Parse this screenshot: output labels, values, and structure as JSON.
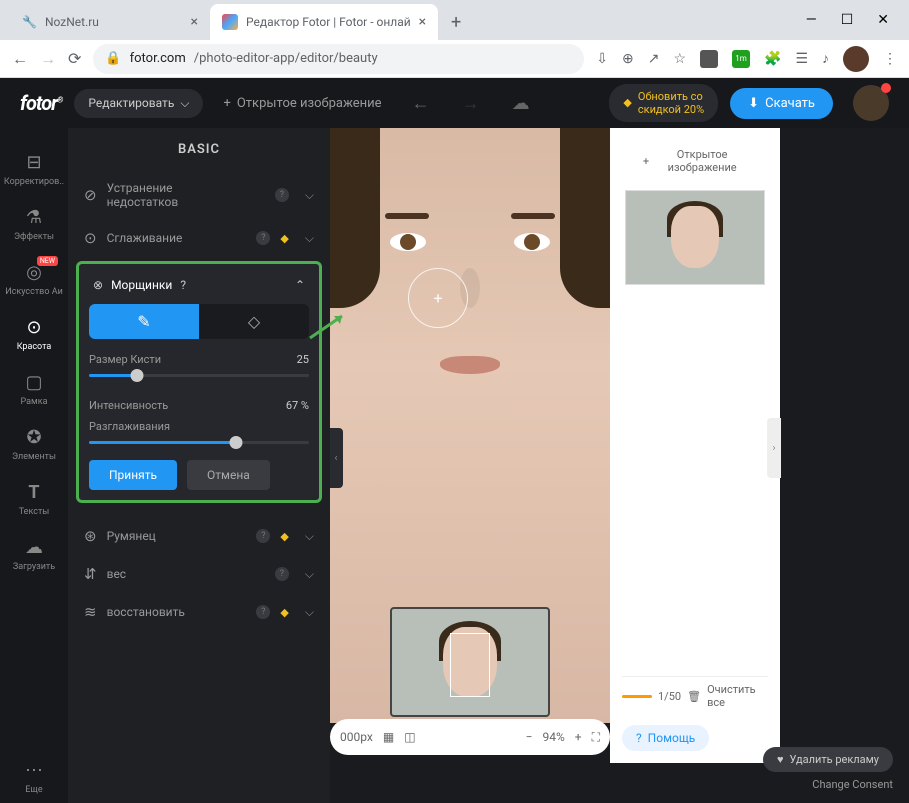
{
  "browser": {
    "tabs": [
      {
        "title": "NozNet.ru",
        "active": false
      },
      {
        "title": "Редактор Fotor | Fotor - онлай",
        "active": true
      }
    ],
    "url_host": "fotor.com",
    "url_path": "/photo-editor-app/editor/beauty",
    "ext_badge": "1m"
  },
  "topbar": {
    "logo": "fotor",
    "edit": "Редактировать",
    "open": "Открытое изображение",
    "promo_line1": "Обновить со",
    "promo_line2": "скидкой 20%",
    "download": "Скачать"
  },
  "leftmenu": {
    "items": [
      {
        "label": "Корректиров..",
        "icon": "≡"
      },
      {
        "label": "Эффекты",
        "icon": "⚗"
      },
      {
        "label": "Искусство Аи",
        "icon": "◎",
        "badge": "NEW"
      },
      {
        "label": "Красота",
        "icon": "⊙",
        "active": true
      },
      {
        "label": "Рамка",
        "icon": "▢"
      },
      {
        "label": "Элементы",
        "icon": "✪"
      },
      {
        "label": "Тексты",
        "icon": "T"
      },
      {
        "label": "Загрузить",
        "icon": "☁"
      }
    ],
    "more": "Еще"
  },
  "panel": {
    "title": "BASIC",
    "tools": {
      "blemish_l1": "Устранение",
      "blemish_l2": "недостатков",
      "smooth": "Сглаживание",
      "wrinkles": "Морщинки",
      "blush": "Румянец",
      "weight": "вес",
      "restore": "восстановить"
    },
    "brush_size_label": "Размер Кисти",
    "brush_size_value": "25",
    "intensity_label": "Интенсивность",
    "intensity_value": "67 %",
    "smooth_slider_label": "Разглаживания",
    "accept": "Принять",
    "cancel": "Отмена"
  },
  "canvas": {
    "dims": "000px",
    "zoom": "94%"
  },
  "right": {
    "add": "Открытое изображение",
    "counter": "1/50",
    "clear": "Очистить все",
    "help": "Помощь"
  },
  "footer": {
    "remove_ads": "Удалить рекламу",
    "consent": "Change Consent"
  },
  "chart_data": null
}
